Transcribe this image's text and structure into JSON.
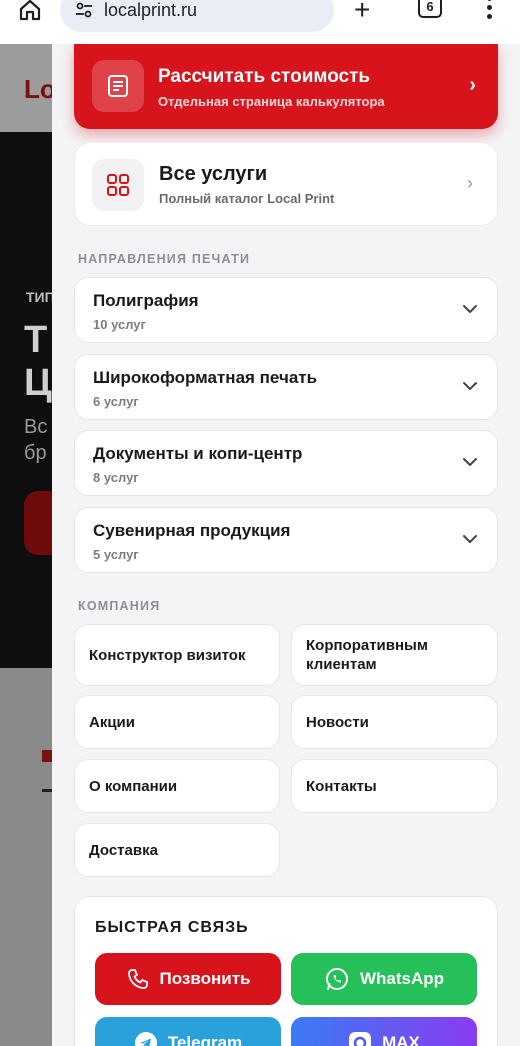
{
  "browser": {
    "url": "localprint.ru",
    "tab_count": "6"
  },
  "background_page": {
    "logo": "Lo",
    "label": "ТИП",
    "heading_line1": "Т",
    "heading_line2": "Ц",
    "text_line1": "Вс",
    "text_line2": "бр"
  },
  "menu": {
    "calculator": {
      "title": "Рассчитать стоимость",
      "subtitle": "Отдельная страница калькулятора"
    },
    "all_services": {
      "title": "Все услуги",
      "subtitle": "Полный каталог Local Print"
    },
    "directions_label": "НАПРАВЛЕНИЯ ПЕЧАТИ",
    "directions": [
      {
        "name": "Полиграфия",
        "count": "10 услуг"
      },
      {
        "name": "Широкоформатная печать",
        "count": "6 услуг"
      },
      {
        "name": "Документы и копи-центр",
        "count": "8 услуг"
      },
      {
        "name": "Сувенирная продукция",
        "count": "5 услуг"
      }
    ],
    "company_label": "КОМПАНИЯ",
    "company_links": [
      "Конструктор визиток",
      "Корпоративным клиентам",
      "Акции",
      "Новости",
      "О компании",
      "Контакты",
      "Доставка"
    ],
    "quick_contact": {
      "title": "БЫСТРАЯ СВЯЗЬ",
      "call": "Позвонить",
      "whatsapp": "WhatsApp",
      "telegram": "Telegram",
      "max": "MAX"
    }
  },
  "colors": {
    "brand_red": "#d7141c",
    "whatsapp_green": "#25c05a",
    "telegram_blue": "#2aa1db"
  }
}
